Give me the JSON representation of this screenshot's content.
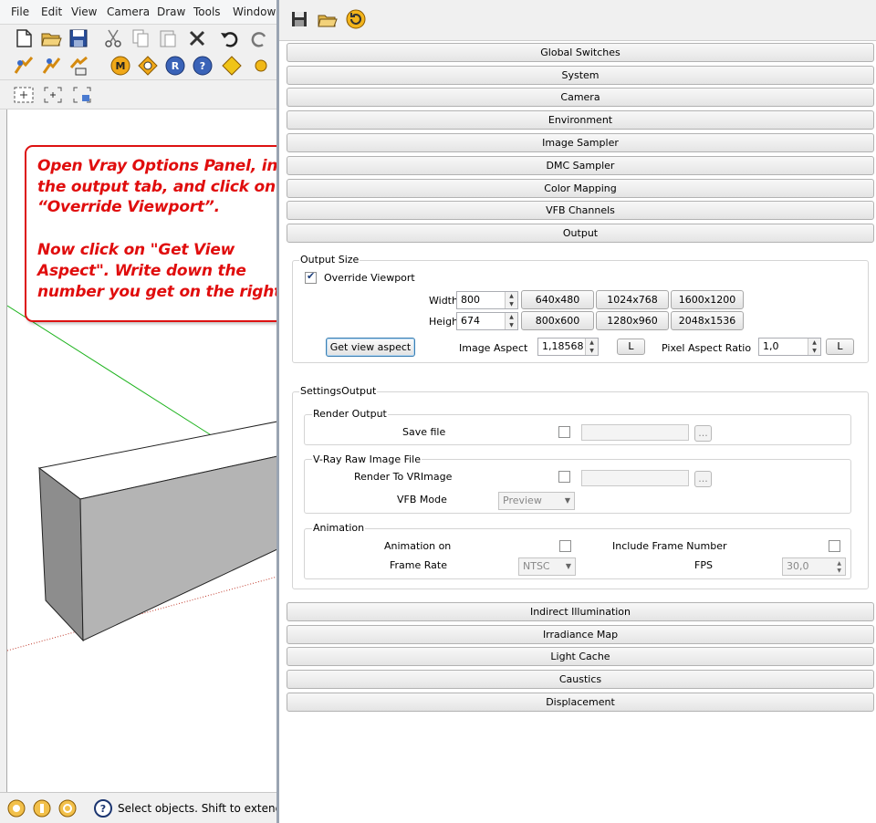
{
  "sketchup": {
    "menu": [
      "File",
      "Edit",
      "View",
      "Camera",
      "Draw",
      "Tools",
      "Window"
    ],
    "status_text": "Select objects. Shift to extend",
    "callout": {
      "lines": [
        "Open Vray Options Panel, in",
        "the output tab, and click on",
        "“Override Viewport”.",
        "",
        "Now click on \"Get View",
        "Aspect\". Write down the",
        "number you get on the right."
      ],
      "color": "#e00d0d"
    }
  },
  "vray": {
    "toolbar_icons": [
      "save-icon",
      "open-icon",
      "reset-icon"
    ],
    "rollouts_top": [
      "Global Switches",
      "System",
      "Camera",
      "Environment",
      "Image Sampler",
      "DMC Sampler",
      "Color Mapping",
      "VFB Channels",
      "Output"
    ],
    "output": {
      "group_title": "Output Size",
      "override_label": "Override Viewport",
      "override_checked": true,
      "width_label": "Width",
      "width_value": "800",
      "height_label": "Height",
      "height_value": "674",
      "presets_row1": [
        "640x480",
        "1024x768",
        "1600x1200"
      ],
      "presets_row2": [
        "800x600",
        "1280x960",
        "2048x1536"
      ],
      "get_aspect_button": "Get view aspect",
      "image_aspect_label": "Image Aspect",
      "image_aspect_value": "1,18568",
      "lock_label": "L",
      "pixel_aspect_label": "Pixel Aspect Ratio",
      "pixel_aspect_value": "1,0"
    },
    "settings_output": {
      "title": "SettingsOutput",
      "render_output": {
        "title": "Render Output",
        "save_file_label": "Save file",
        "ellipsis": "..."
      },
      "vray_raw": {
        "title": "V-Ray Raw Image File",
        "render_to_label": "Render To VRImage",
        "vfb_mode_label": "VFB Mode",
        "vfb_mode_value": "Preview",
        "ellipsis": "..."
      },
      "animation": {
        "title": "Animation",
        "animation_on_label": "Animation on",
        "include_frame_label": "Include Frame Number",
        "frame_rate_label": "Frame Rate",
        "frame_rate_value": "NTSC",
        "fps_label": "FPS",
        "fps_value": "30,0"
      }
    },
    "rollouts_bottom": [
      "Indirect Illumination",
      "Irradiance Map",
      "Light Cache",
      "Caustics",
      "Displacement"
    ]
  }
}
